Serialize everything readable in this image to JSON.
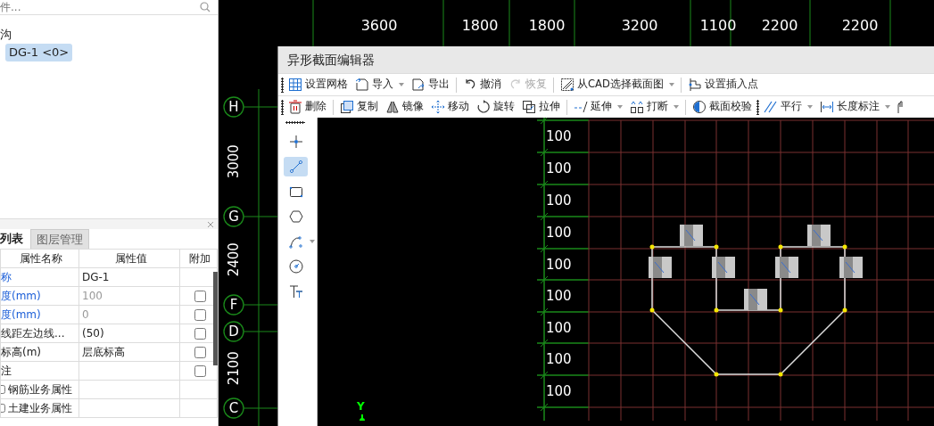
{
  "component_search": {
    "placeholder": "件..."
  },
  "component_tree": [
    {
      "label": "沟",
      "children": [
        {
          "label": "DG-1 <0>",
          "selected": true
        }
      ]
    }
  ],
  "properties_panel": {
    "tabs": [
      {
        "label": "列表",
        "selected": true
      },
      {
        "label": "图层管理",
        "selected": false
      }
    ],
    "columns": [
      "属性名称",
      "属性值",
      "附加"
    ],
    "rows": [
      {
        "kind": "fixed",
        "name": "称",
        "public": true,
        "value": "DG-1",
        "disabled": false
      },
      {
        "kind": "field",
        "name": "度(mm)",
        "public": true,
        "value": "100",
        "disabled": true,
        "checked": false
      },
      {
        "kind": "field",
        "name": "度(mm)",
        "public": true,
        "value": "0",
        "disabled": true,
        "checked": false
      },
      {
        "kind": "field",
        "name": "线距左边线...",
        "public": false,
        "value": "(50)",
        "disabled": false,
        "checked": false
      },
      {
        "kind": "field",
        "name": "标高(m)",
        "public": false,
        "value": "层底标高",
        "disabled": false,
        "checked": false
      },
      {
        "kind": "field",
        "name": "注",
        "public": false,
        "checked": false
      },
      {
        "kind": "group",
        "name": "钢筋业务属性"
      },
      {
        "kind": "group",
        "name": "土建业务属性"
      }
    ]
  },
  "cad_view": {
    "column_dimensions": [
      "3600",
      "1800",
      "1800",
      "3200",
      "1100",
      "2200",
      "2200"
    ],
    "axes": [
      "H",
      "G",
      "F",
      "D",
      "C"
    ],
    "row_dimensions": [
      "3000",
      "2400",
      "2100"
    ]
  },
  "editor": {
    "title": "异形截面编辑器",
    "toolbar_1": [
      {
        "kind": "button",
        "label": "设置网格",
        "dropdown": false,
        "disabled": false
      },
      {
        "kind": "button",
        "label": "导入",
        "dropdown": true,
        "disabled": false
      },
      {
        "kind": "button",
        "label": "导出",
        "dropdown": false,
        "disabled": false
      },
      {
        "kind": "separator"
      },
      {
        "kind": "button",
        "label": "撤消",
        "dropdown": false,
        "disabled": false
      },
      {
        "kind": "button",
        "label": "恢复",
        "dropdown": false,
        "disabled": true
      },
      {
        "kind": "separator"
      },
      {
        "kind": "button",
        "label": "从CAD选择截面图",
        "dropdown": true,
        "disabled": false
      },
      {
        "kind": "separator"
      },
      {
        "kind": "button",
        "label": "设置插入点",
        "dropdown": false,
        "disabled": false
      }
    ],
    "toolbar_2": [
      {
        "kind": "button",
        "label": "删除",
        "dropdown": false,
        "disabled": false
      },
      {
        "kind": "separator"
      },
      {
        "kind": "button",
        "label": "复制",
        "dropdown": false,
        "disabled": false
      },
      {
        "kind": "button",
        "label": "镜像",
        "dropdown": false,
        "disabled": false
      },
      {
        "kind": "button",
        "label": "移动",
        "dropdown": false,
        "disabled": false
      },
      {
        "kind": "button",
        "label": "旋转",
        "dropdown": false,
        "disabled": false
      },
      {
        "kind": "button",
        "label": "拉伸",
        "dropdown": false,
        "disabled": false
      },
      {
        "kind": "separator"
      },
      {
        "kind": "button",
        "label": "延伸",
        "dropdown": true,
        "disabled": false
      },
      {
        "kind": "button",
        "label": "打断",
        "dropdown": true,
        "disabled": false
      },
      {
        "kind": "separator"
      },
      {
        "kind": "button",
        "label": "截面校验",
        "dropdown": false,
        "disabled": false
      },
      {
        "kind": "grip"
      },
      {
        "kind": "button",
        "label": "平行",
        "dropdown": true,
        "disabled": false
      },
      {
        "kind": "button",
        "label": "长度标注",
        "dropdown": true,
        "disabled": false
      },
      {
        "kind": "icon"
      }
    ],
    "draw_tools": [
      {
        "selected": false,
        "dropdown": false
      },
      {
        "selected": true,
        "dropdown": false
      },
      {
        "selected": false,
        "dropdown": false
      },
      {
        "selected": false,
        "dropdown": false
      },
      {
        "selected": false,
        "dropdown": true
      },
      {
        "selected": false,
        "dropdown": false
      },
      {
        "selected": false,
        "dropdown": false
      }
    ],
    "grid_labels": [
      "100",
      "100",
      "100",
      "100",
      "100",
      "100",
      "100",
      "100",
      "100"
    ],
    "axis_label": "Y"
  }
}
